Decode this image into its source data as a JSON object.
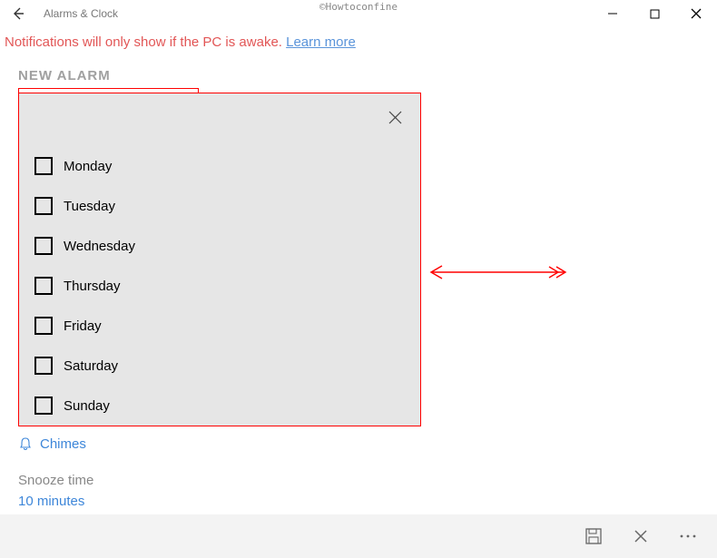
{
  "titlebar": {
    "app_name": "Alarms & Clock",
    "watermark": "©Howtoconfine"
  },
  "notification": {
    "text": "Notifications will only show if the PC is awake. ",
    "link": "Learn more"
  },
  "heading": "NEW ALARM",
  "days": {
    "items": [
      {
        "label": "Monday",
        "checked": false
      },
      {
        "label": "Tuesday",
        "checked": false
      },
      {
        "label": "Wednesday",
        "checked": false
      },
      {
        "label": "Thursday",
        "checked": false
      },
      {
        "label": "Friday",
        "checked": false
      },
      {
        "label": "Saturday",
        "checked": false
      },
      {
        "label": "Sunday",
        "checked": false
      }
    ]
  },
  "sound": {
    "label": "Chimes"
  },
  "snooze": {
    "label": "Snooze time",
    "value": "10 minutes"
  },
  "annotation": {
    "arrow_color": "#ff0000"
  }
}
